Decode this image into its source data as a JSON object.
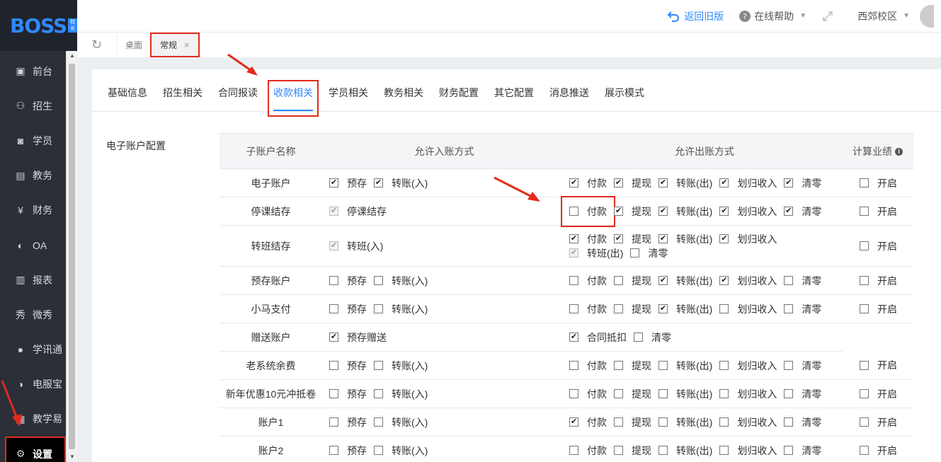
{
  "logo": {
    "text": "BOSS",
    "badge": "校长"
  },
  "sidebar": {
    "items": [
      {
        "label": "前台",
        "icon": "calendar-icon"
      },
      {
        "label": "招生",
        "icon": "user-plus-icon"
      },
      {
        "label": "学员",
        "icon": "id-card-icon"
      },
      {
        "label": "教务",
        "icon": "book-icon"
      },
      {
        "label": "财务",
        "icon": "yen-icon"
      },
      {
        "label": "OA",
        "icon": "chat-icon"
      },
      {
        "label": "报表",
        "icon": "bar-chart-icon"
      },
      {
        "label": "微秀",
        "icon": "xiu-icon"
      },
      {
        "label": "学讯通",
        "icon": "location-pin-icon"
      },
      {
        "label": "电服宝",
        "icon": "phone-service-icon"
      },
      {
        "label": "教学易",
        "icon": "teach-icon"
      },
      {
        "label": "设置",
        "icon": "gear-icon"
      }
    ]
  },
  "topbar": {
    "back_old": "返回旧版",
    "help": "在线帮助",
    "campus": "西郊校区"
  },
  "page_tabs": {
    "home": "桌面",
    "current": "常规",
    "close": "×"
  },
  "config_tabs": [
    "基础信息",
    "招生相关",
    "合同报读",
    "收款相关",
    "学员相关",
    "教务相关",
    "财务配置",
    "其它配置",
    "消息推送",
    "展示模式"
  ],
  "section_label": "电子账户配置",
  "table": {
    "headers": {
      "name": "子账户名称",
      "in": "允许入账方式",
      "out": "允许出账方式",
      "perf": "计算业绩"
    },
    "rows": [
      {
        "name": "电子账户",
        "in": [
          {
            "label": "预存",
            "checked": true
          },
          {
            "label": "转账(入)",
            "checked": true
          }
        ],
        "out": [
          {
            "label": "付款",
            "checked": true
          },
          {
            "label": "提现",
            "checked": true
          },
          {
            "label": "转账(出)",
            "checked": true
          },
          {
            "label": "划归收入",
            "checked": true
          },
          {
            "label": "清零",
            "checked": true
          }
        ],
        "perf": {
          "label": "开启",
          "checked": false
        }
      },
      {
        "name": "停课结存",
        "in": [
          {
            "label": "停课结存",
            "checked": true,
            "disabled": true
          }
        ],
        "out": [
          {
            "label": "付款",
            "checked": false
          },
          {
            "label": "提现",
            "checked": true
          },
          {
            "label": "转账(出)",
            "checked": true
          },
          {
            "label": "划归收入",
            "checked": true
          },
          {
            "label": "清零",
            "checked": true
          }
        ],
        "perf": {
          "label": "开启",
          "checked": false
        }
      },
      {
        "name": "转班结存",
        "in": [
          {
            "label": "转班(入)",
            "checked": true,
            "disabled": true
          }
        ],
        "out": [
          {
            "label": "付款",
            "checked": true
          },
          {
            "label": "提现",
            "checked": true
          },
          {
            "label": "转账(出)",
            "checked": true
          },
          {
            "label": "划归收入",
            "checked": true
          },
          {
            "label": "转班(出)",
            "checked": true,
            "disabled": true
          },
          {
            "label": "清零",
            "checked": false
          }
        ],
        "perf": {
          "label": "开启",
          "checked": false
        }
      },
      {
        "name": "预存账户",
        "in": [
          {
            "label": "预存",
            "checked": false
          },
          {
            "label": "转账(入)",
            "checked": false
          }
        ],
        "out": [
          {
            "label": "付款",
            "checked": false
          },
          {
            "label": "提现",
            "checked": false
          },
          {
            "label": "转账(出)",
            "checked": true
          },
          {
            "label": "划归收入",
            "checked": true
          },
          {
            "label": "清零",
            "checked": false
          }
        ],
        "perf": {
          "label": "开启",
          "checked": false
        }
      },
      {
        "name": "小马支付",
        "in": [
          {
            "label": "预存",
            "checked": false
          },
          {
            "label": "转账(入)",
            "checked": false
          }
        ],
        "out": [
          {
            "label": "付款",
            "checked": false
          },
          {
            "label": "提现",
            "checked": false
          },
          {
            "label": "转账(出)",
            "checked": true
          },
          {
            "label": "划归收入",
            "checked": false
          },
          {
            "label": "清零",
            "checked": false
          }
        ],
        "perf": {
          "label": "开启",
          "checked": false
        }
      },
      {
        "name": "赠送账户",
        "in": [
          {
            "label": "预存赠送",
            "checked": true
          }
        ],
        "out": [
          {
            "label": "合同抵扣",
            "checked": true
          },
          {
            "label": "清零",
            "checked": false
          }
        ],
        "perf": null
      },
      {
        "name": "老系统余费",
        "in": [
          {
            "label": "预存",
            "checked": false
          },
          {
            "label": "转账(入)",
            "checked": false
          }
        ],
        "out": [
          {
            "label": "付款",
            "checked": false
          },
          {
            "label": "提现",
            "checked": false
          },
          {
            "label": "转账(出)",
            "checked": false
          },
          {
            "label": "划归收入",
            "checked": false
          },
          {
            "label": "清零",
            "checked": false
          }
        ],
        "perf": {
          "label": "开启",
          "checked": false
        }
      },
      {
        "name": "新年优惠10元冲抵卷",
        "in": [
          {
            "label": "预存",
            "checked": false
          },
          {
            "label": "转账(入)",
            "checked": false
          }
        ],
        "out": [
          {
            "label": "付款",
            "checked": false
          },
          {
            "label": "提现",
            "checked": false
          },
          {
            "label": "转账(出)",
            "checked": false
          },
          {
            "label": "划归收入",
            "checked": false
          },
          {
            "label": "清零",
            "checked": false
          }
        ],
        "perf": {
          "label": "开启",
          "checked": false
        }
      },
      {
        "name": "账户1",
        "in": [
          {
            "label": "预存",
            "checked": false
          },
          {
            "label": "转账(入)",
            "checked": false
          }
        ],
        "out": [
          {
            "label": "付款",
            "checked": true
          },
          {
            "label": "提现",
            "checked": false
          },
          {
            "label": "转账(出)",
            "checked": false
          },
          {
            "label": "划归收入",
            "checked": false
          },
          {
            "label": "清零",
            "checked": false
          }
        ],
        "perf": {
          "label": "开启",
          "checked": false
        }
      },
      {
        "name": "账户2",
        "in": [
          {
            "label": "预存",
            "checked": false
          },
          {
            "label": "转账(入)",
            "checked": false
          }
        ],
        "out": [
          {
            "label": "付款",
            "checked": false
          },
          {
            "label": "提现",
            "checked": false
          },
          {
            "label": "转账(出)",
            "checked": false
          },
          {
            "label": "划归收入",
            "checked": false
          },
          {
            "label": "清零",
            "checked": false
          }
        ],
        "perf": {
          "label": "开启",
          "checked": false
        }
      }
    ]
  },
  "colors": {
    "accent": "#2f88ff",
    "annotation": "#e32a1c",
    "sidebar_bg": "#2a2f38"
  }
}
